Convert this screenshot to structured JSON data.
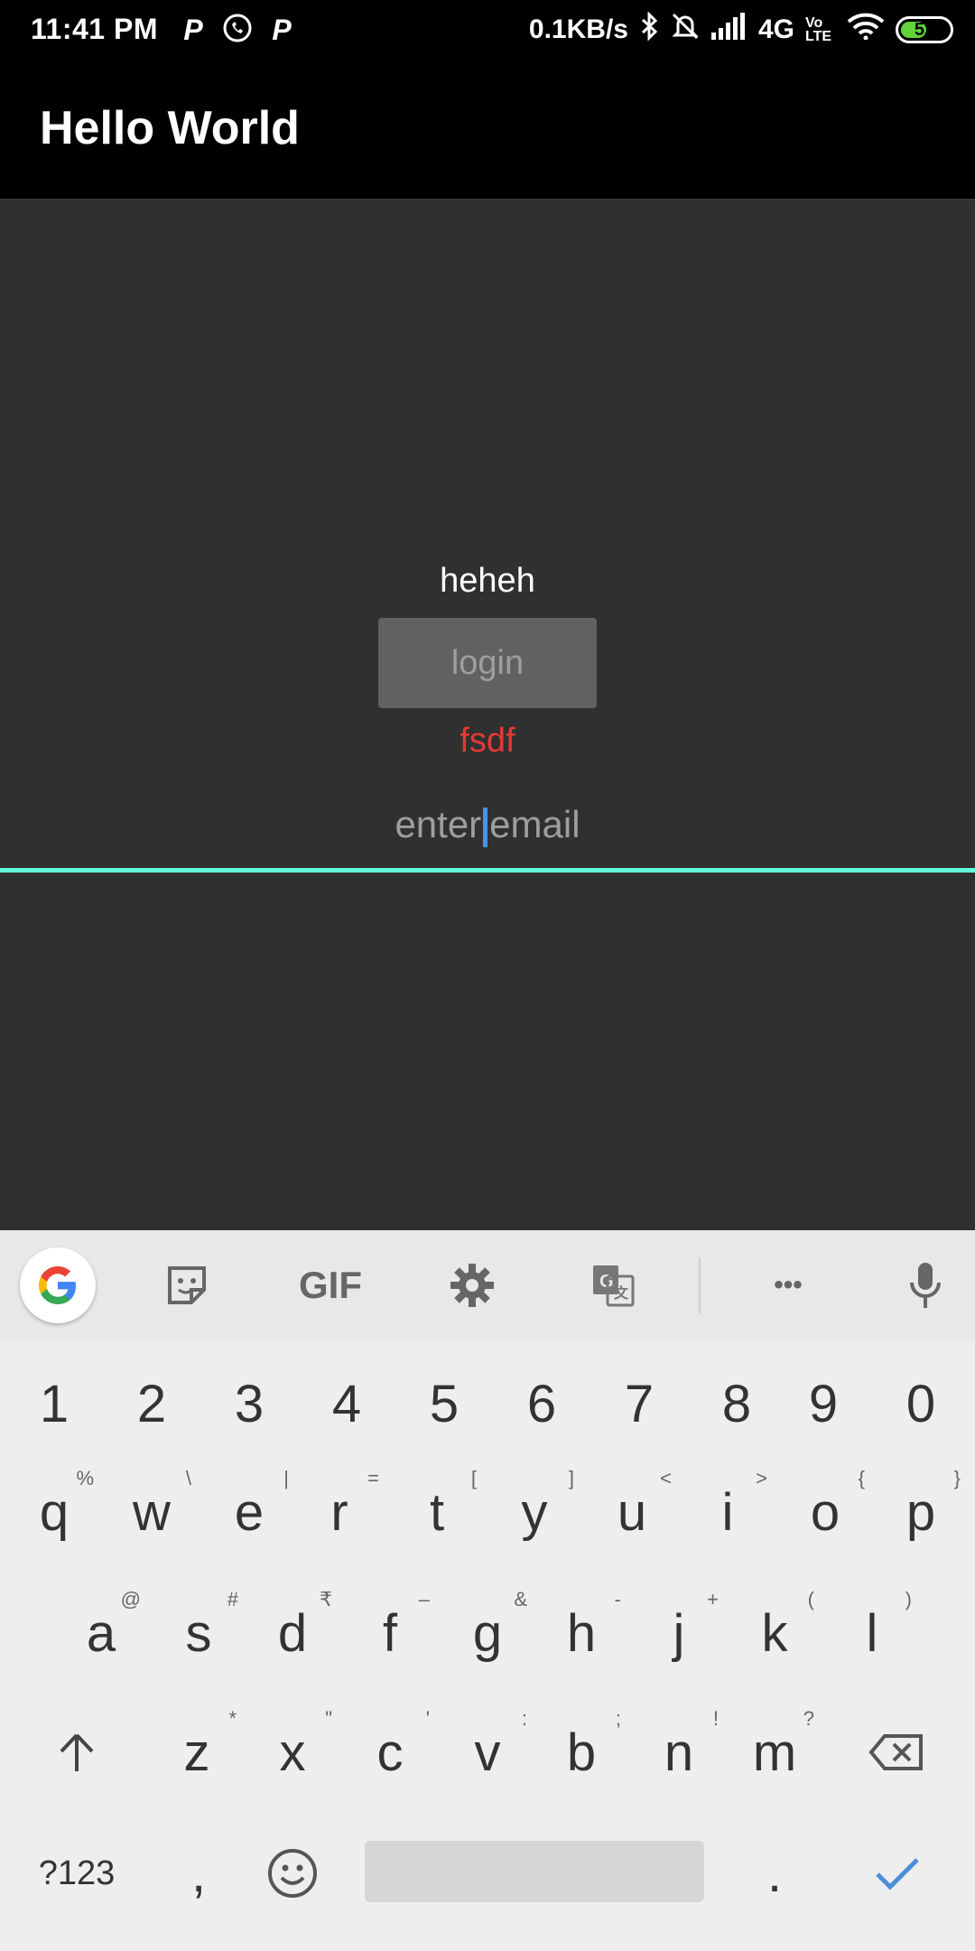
{
  "status_bar": {
    "time": "11:41 PM",
    "left_icons": [
      "P",
      "P"
    ],
    "net_speed": "0.1KB/s",
    "network": "4G",
    "volte": "Vo LTE",
    "battery": "52"
  },
  "app_bar": {
    "title": "Hello World"
  },
  "content": {
    "label_top": "heheh",
    "login_label": "login",
    "label_error": "fsdf",
    "email_placeholder_before": "enter",
    "email_placeholder_after": "email"
  },
  "keyboard": {
    "toolbar": {
      "gif_label": "GIF",
      "more_label": "•••"
    },
    "number_row": [
      "1",
      "2",
      "3",
      "4",
      "5",
      "6",
      "7",
      "8",
      "9",
      "0"
    ],
    "row1": [
      {
        "k": "q",
        "s": "%"
      },
      {
        "k": "w",
        "s": "\\"
      },
      {
        "k": "e",
        "s": "|"
      },
      {
        "k": "r",
        "s": "="
      },
      {
        "k": "t",
        "s": "["
      },
      {
        "k": "y",
        "s": "]"
      },
      {
        "k": "u",
        "s": "<"
      },
      {
        "k": "i",
        "s": ">"
      },
      {
        "k": "o",
        "s": "{"
      },
      {
        "k": "p",
        "s": "}"
      }
    ],
    "row2": [
      {
        "k": "a",
        "s": "@"
      },
      {
        "k": "s",
        "s": "#"
      },
      {
        "k": "d",
        "s": "₹"
      },
      {
        "k": "f",
        "s": "–"
      },
      {
        "k": "g",
        "s": "&"
      },
      {
        "k": "h",
        "s": "-"
      },
      {
        "k": "j",
        "s": "+"
      },
      {
        "k": "k",
        "s": "("
      },
      {
        "k": "l",
        "s": ")"
      }
    ],
    "row3": [
      {
        "k": "z",
        "s": "*"
      },
      {
        "k": "x",
        "s": "\""
      },
      {
        "k": "c",
        "s": "'"
      },
      {
        "k": "v",
        "s": ":"
      },
      {
        "k": "b",
        "s": ";"
      },
      {
        "k": "n",
        "s": "!"
      },
      {
        "k": "m",
        "s": "?"
      }
    ],
    "bottom": {
      "symbols_label": "?123",
      "comma": ",",
      "period": "."
    },
    "colors": {
      "accent": "#4a90d9"
    }
  }
}
